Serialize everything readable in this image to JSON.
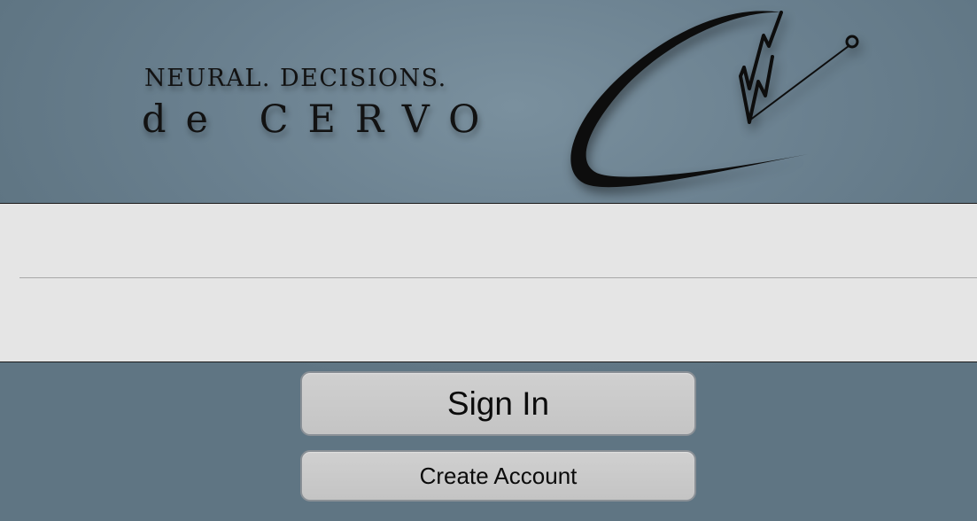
{
  "header": {
    "tagline": "NEURAL. DECISIONS.",
    "brand": "de CERVO",
    "logo_icon": "cervo-signature-icon"
  },
  "login_form": {
    "username": {
      "value": "",
      "placeholder": ""
    },
    "password": {
      "value": "",
      "placeholder": ""
    }
  },
  "actions": {
    "sign_in_label": "Sign In",
    "create_account_label": "Create Account"
  },
  "colors": {
    "background": "#6a808f",
    "panel": "#e5e5e5",
    "button": "#c9c9c9",
    "text": "#121212"
  }
}
